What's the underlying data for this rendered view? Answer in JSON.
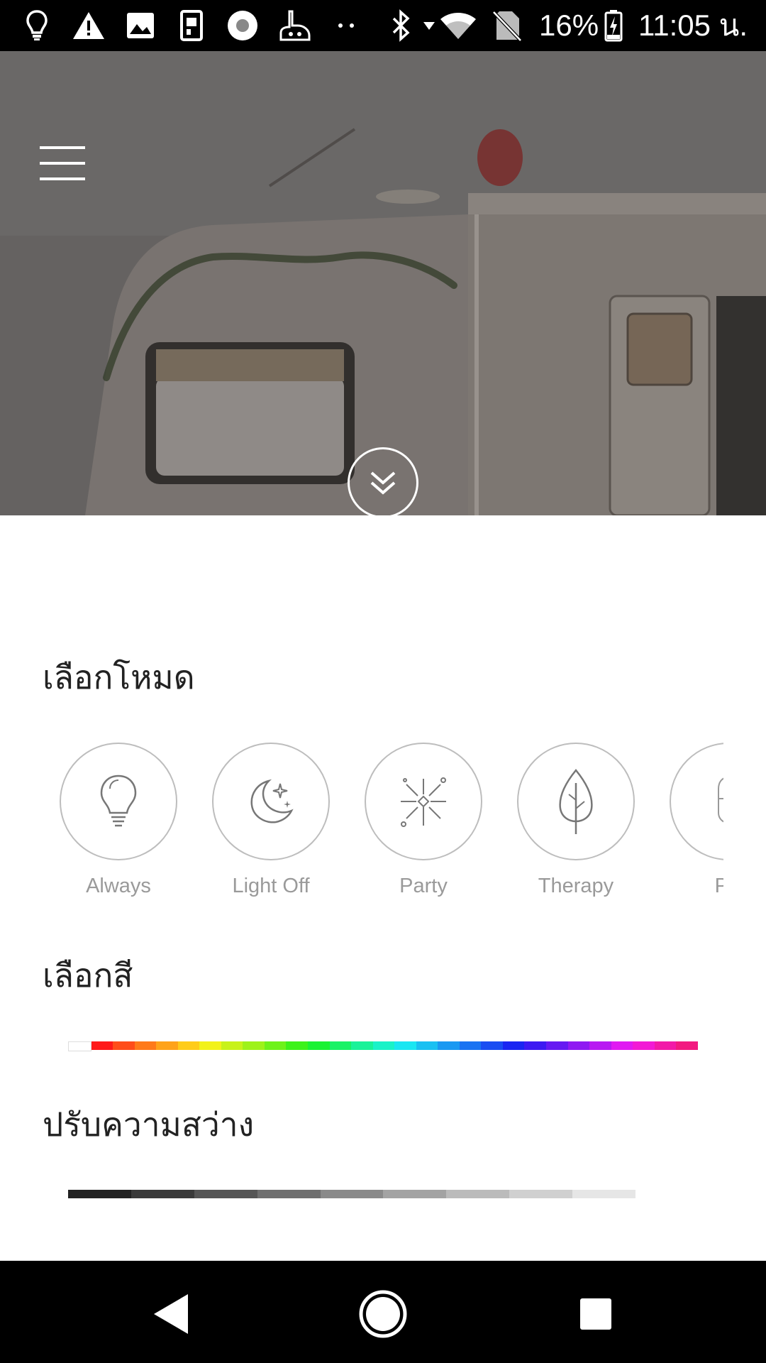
{
  "status_bar": {
    "icons": [
      "bulb-icon",
      "warning-icon",
      "image-icon",
      "sim-icon",
      "record-icon",
      "hand-app-icon",
      "more-dots-icon",
      "bluetooth-icon",
      "wifi-icon",
      "no-sim-icon",
      "battery-icon"
    ],
    "battery_percent": "16%",
    "time": "11:05 น."
  },
  "hero": {
    "menu_icon": "hamburger-menu-icon",
    "expand_icon": "double-chevron-down-icon"
  },
  "sections": {
    "mode_title": "เลือกโหมด",
    "color_title": "เลือกสี",
    "brightness_title": "ปรับความสว่าง"
  },
  "modes": [
    {
      "label": "Always",
      "icon": "lightbulb-icon"
    },
    {
      "label": "Light Off",
      "icon": "moon-stars-icon"
    },
    {
      "label": "Party",
      "icon": "firework-icon"
    },
    {
      "label": "Therapy",
      "icon": "leaf-icon"
    },
    {
      "label": "PP",
      "icon": "lantern-icon"
    }
  ],
  "color_palette": [
    "#ffffff",
    "#ff1a1a",
    "#ff4d1a",
    "#ff7a1a",
    "#ffa31a",
    "#ffcc1a",
    "#f2f21a",
    "#c8f21a",
    "#9ef21a",
    "#6ef21a",
    "#3df21a",
    "#1af233",
    "#1af266",
    "#1af299",
    "#1af2c8",
    "#1ae6f2",
    "#1ac0f2",
    "#1a99f2",
    "#1a73f2",
    "#1a4df2",
    "#1a26f2",
    "#3d1af2",
    "#661af2",
    "#8f1af2",
    "#b81af2",
    "#e01af2",
    "#f21ad5",
    "#f21aa8",
    "#f21a80"
  ],
  "brightness_palette": [
    "#222222",
    "#3a3a3a",
    "#555555",
    "#6f6f6f",
    "#8a8a8a",
    "#a3a3a3",
    "#bbbbbb",
    "#d0d0d0",
    "#e6e6e6"
  ],
  "nav": {
    "back_icon": "back-triangle-icon",
    "home_icon": "home-circle-icon",
    "recents_icon": "recents-square-icon"
  }
}
